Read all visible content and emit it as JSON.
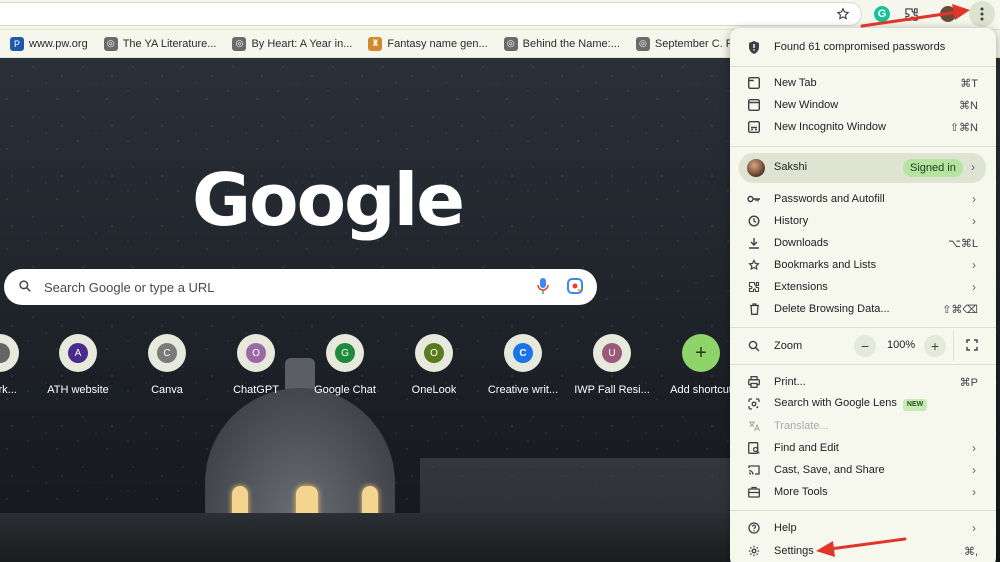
{
  "toolbar": {
    "icons": [
      "star-icon",
      "grammarly-icon",
      "extensions-icon",
      "profile-icon",
      "kebab-menu-icon"
    ],
    "grammarly_letter": "G"
  },
  "bookmarks": [
    {
      "label": "www.pw.org",
      "color": "#1f5aa8",
      "glyph": "P"
    },
    {
      "label": "The YA Literature...",
      "color": "#6b6b6b",
      "glyph": "◎"
    },
    {
      "label": "By Heart: A Year in...",
      "color": "#6b6b6b",
      "glyph": "◎"
    },
    {
      "label": "Fantasy name gen...",
      "color": "#d08a2b",
      "glyph": "♜"
    },
    {
      "label": "Behind the Name:...",
      "color": "#6b6b6b",
      "glyph": "◎"
    },
    {
      "label": "September C. Faw...",
      "color": "#6b6b6b",
      "glyph": "◎"
    }
  ],
  "ntp": {
    "logo": "Google",
    "search_placeholder": "Search Google or type a URL",
    "shortcuts": [
      {
        "label": "Mark...",
        "letter": "",
        "color": "#666"
      },
      {
        "label": "ATH website",
        "letter": "A",
        "color": "#4a2a8a"
      },
      {
        "label": "Canva",
        "letter": "C",
        "color": "#7a7a7a"
      },
      {
        "label": "ChatGPT",
        "letter": "O",
        "color": "#9a6aa6"
      },
      {
        "label": "Google Chat",
        "letter": "G",
        "color": "#1e8a3a"
      },
      {
        "label": "OneLook",
        "letter": "O",
        "color": "#5a7a1e"
      },
      {
        "label": "Creative writ...",
        "letter": "C",
        "color": "#1a73e8"
      },
      {
        "label": "IWP Fall Resi...",
        "letter": "U",
        "color": "#9a5a7a"
      },
      {
        "label": "Add shortcut",
        "letter": "+",
        "color": "#8fd46a"
      }
    ]
  },
  "menu": {
    "passwords_alert": "Found 61 compromised passwords",
    "new_tab": {
      "label": "New Tab",
      "shortcut": "⌘T"
    },
    "new_window": {
      "label": "New Window",
      "shortcut": "⌘N"
    },
    "new_incognito": {
      "label": "New Incognito Window",
      "shortcut": "⇧⌘N"
    },
    "profile": {
      "name": "Sakshi",
      "status": "Signed in"
    },
    "passwords_autofill": "Passwords and Autofill",
    "history": "History",
    "downloads": {
      "label": "Downloads",
      "shortcut": "⌥⌘L"
    },
    "bookmarks_lists": "Bookmarks and Lists",
    "extensions": "Extensions",
    "delete_browsing": {
      "label": "Delete Browsing Data...",
      "shortcut": "⇧⌘⌫"
    },
    "zoom": {
      "label": "Zoom",
      "value": "100%",
      "minus": "−",
      "plus": "+"
    },
    "print": {
      "label": "Print...",
      "shortcut": "⌘P"
    },
    "search_lens": {
      "label": "Search with Google Lens",
      "badge": "NEW"
    },
    "translate": "Translate...",
    "find_edit": "Find and Edit",
    "cast_save": "Cast, Save, and Share",
    "more_tools": "More Tools",
    "help": "Help",
    "settings": {
      "label": "Settings",
      "shortcut": "⌘,"
    }
  },
  "colors": {
    "accent_arrow": "#e0352b",
    "signed_in_badge": "#b6e3a1"
  }
}
